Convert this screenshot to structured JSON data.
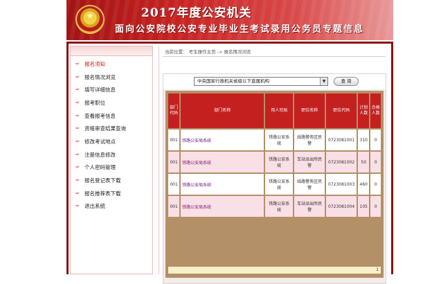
{
  "banner": {
    "title": "2017年度公安机关",
    "subtitle": "面向公安院校公安专业毕业生考试录用公务员专题信息"
  },
  "sidebar": {
    "items": [
      {
        "label": "报名须知",
        "active": true
      },
      {
        "label": "报名情况浏览",
        "active": false
      },
      {
        "label": "填写详细信息",
        "active": false
      },
      {
        "label": "报考职位",
        "active": false
      },
      {
        "label": "查看报考信息",
        "active": false
      },
      {
        "label": "资格审查结果查询",
        "active": false
      },
      {
        "label": "修改考试地点",
        "active": false
      },
      {
        "label": "注册信息修改",
        "active": false
      },
      {
        "label": "个人密码管理",
        "active": false
      },
      {
        "label": "报名登记表下载",
        "active": false
      },
      {
        "label": "报名推荐表下载",
        "active": false
      },
      {
        "label": "退出系统",
        "active": false
      }
    ]
  },
  "breadcrumb": "当前位置： 考生操作主页 -> 报名情况浏览",
  "search": {
    "select_value": "中央国家行政机关省级以下直属机构",
    "button_label": "查 询"
  },
  "table": {
    "headers": [
      "部门代码",
      "部门名称",
      "用人司局",
      "职位名称",
      "职位代码",
      "计划人数",
      "合格人数"
    ],
    "rows": [
      [
        "001",
        "铁路公安局系统",
        "铁路公安系统",
        "线路警务区民警",
        "0723081001",
        "310",
        "0"
      ],
      [
        "001",
        "铁路公安局系统",
        "铁路公安系统",
        "车站派出所民警",
        "0723081002",
        "50",
        "0"
      ],
      [
        "001",
        "铁路公安局系统",
        "铁路公安系统",
        "线路警务区民警",
        "0723081003",
        "460",
        "0"
      ],
      [
        "001",
        "铁路公安局系统",
        "铁路公安系统",
        "车站派出所民警",
        "0723081004",
        "105",
        "0"
      ]
    ],
    "pager": "1"
  },
  "colors": {
    "accent": "#c42020",
    "table_frame": "#b39068",
    "row_alt": "#f9dfe6"
  }
}
